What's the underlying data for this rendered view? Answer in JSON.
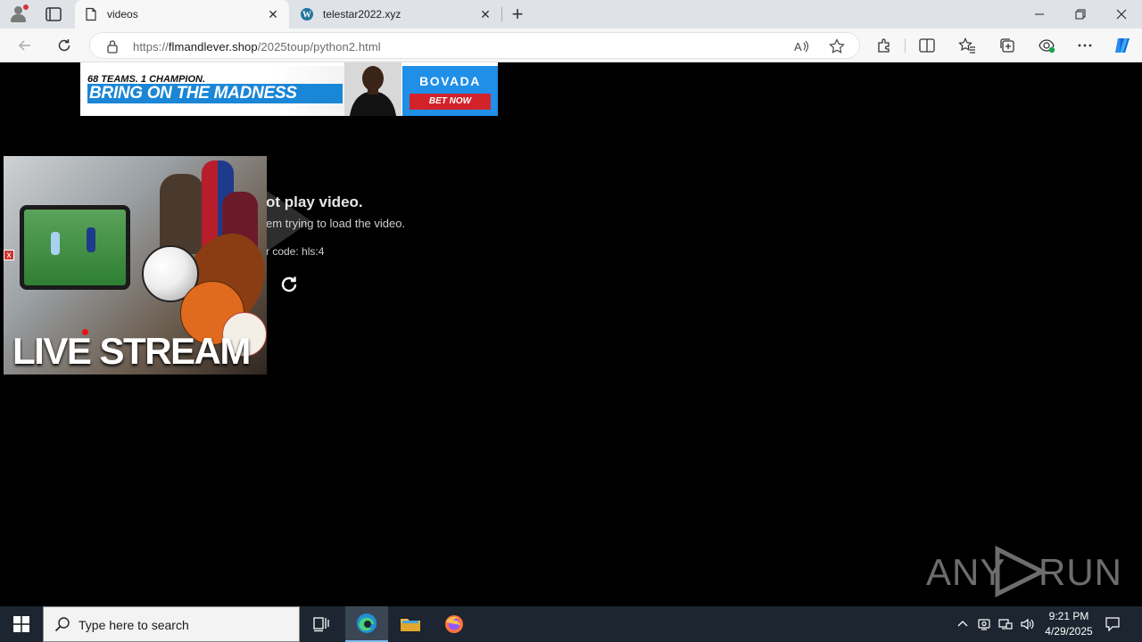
{
  "browser": {
    "tabs": [
      {
        "label": "videos",
        "active": true,
        "icon": "page-icon"
      },
      {
        "label": "telestar2022.xyz",
        "active": false,
        "icon": "wordpress-icon"
      }
    ],
    "address": {
      "prefix": "https://",
      "host": "flmandlever.shop",
      "path": "/2025toup/python2.html"
    }
  },
  "ad_banner": {
    "tagline": "68 TEAMS. 1 CHAMPION.",
    "headline": "BRING ON THE MADNESS",
    "brand": "BOVADA",
    "cta": "BET NOW"
  },
  "player": {
    "error_title": "ot play video.",
    "error_description": "em trying to load the video.",
    "error_code": "r code: hls:4"
  },
  "overlay_ad": {
    "text": "LIVE STREAM",
    "close_label": "x"
  },
  "watermark": {
    "left": "ANY",
    "right": "RUN"
  },
  "taskbar": {
    "search_placeholder": "Type here to search",
    "time": "9:21 PM",
    "date": "4/29/2025"
  },
  "colors": {
    "accent": "#1a86d6",
    "brand_blue": "#1f8fe8",
    "cta_red": "#d2232a",
    "taskbar": "#1c2530"
  }
}
